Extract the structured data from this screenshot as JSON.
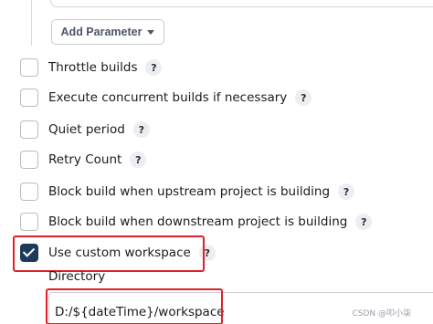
{
  "add_parameter": {
    "label": "Add Parameter",
    "icon": "caret-down-icon"
  },
  "options": [
    {
      "label": "Throttle builds",
      "checked": false,
      "help": "?"
    },
    {
      "label": "Execute concurrent builds if necessary",
      "checked": false,
      "help": "?"
    },
    {
      "label": "Quiet period",
      "checked": false,
      "help": "?"
    },
    {
      "label": "Retry Count",
      "checked": false,
      "help": "?"
    },
    {
      "label": "Block build when upstream project is building",
      "checked": false,
      "help": "?"
    },
    {
      "label": "Block build when downstream project is building",
      "checked": false,
      "help": "?"
    },
    {
      "label": "Use custom workspace",
      "checked": true,
      "help": "?"
    }
  ],
  "directory": {
    "label": "Directory",
    "value": "D:/${dateTime}/workspace"
  },
  "watermark": "CSDN @叩小柒",
  "colors": {
    "checked": "#1d3a5a",
    "highlight": "#e0202a"
  }
}
